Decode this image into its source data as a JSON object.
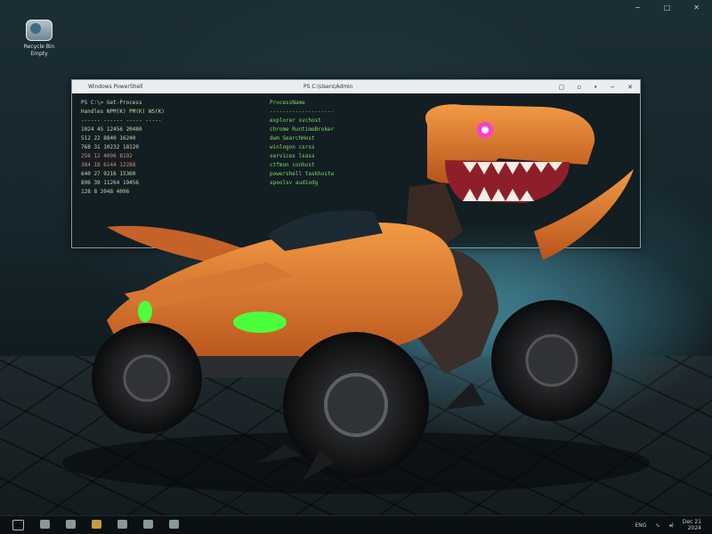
{
  "desktop": {
    "icon_label_line1": "Recycle Bin",
    "icon_label_line2": "Empty"
  },
  "window_controls": [
    "−",
    "□",
    "✕"
  ],
  "terminal": {
    "title_left": "Windows PowerShell",
    "title_center": "PS C:\\Users\\Admin",
    "controls": [
      "▢",
      "▫",
      "•",
      "−",
      "✕"
    ],
    "column_a": [
      "PS C:\\> Get-Process",
      "  Handles  NPM(K)  PM(K)  WS(K)",
      "  ------  ------  -----  -----",
      "    1024     45   12456  20480",
      "     512     22    8840  16240",
      "     768     31   10232  18120",
      "     256     12    4096   8192",
      "     384     18    6144  12288",
      "     640     27    9216  15360",
      "     896     39   11264  19456",
      "     128      8    2048   4096"
    ],
    "column_b": [
      "ProcessName",
      "--------------------",
      "explorer  svchost",
      "chrome  RuntimeBroker",
      "dwm  SearchHost",
      "winlogon  csrss",
      "services  lsass",
      "ctfmon  conhost",
      "powershell  taskhostw",
      "spoolsv  audiodg"
    ]
  },
  "taskbar": {
    "tray_text": "ENG",
    "tray_wifi": "∿",
    "tray_sound": "◂)",
    "clock_time": "Dec 21",
    "clock_date": "2024"
  }
}
